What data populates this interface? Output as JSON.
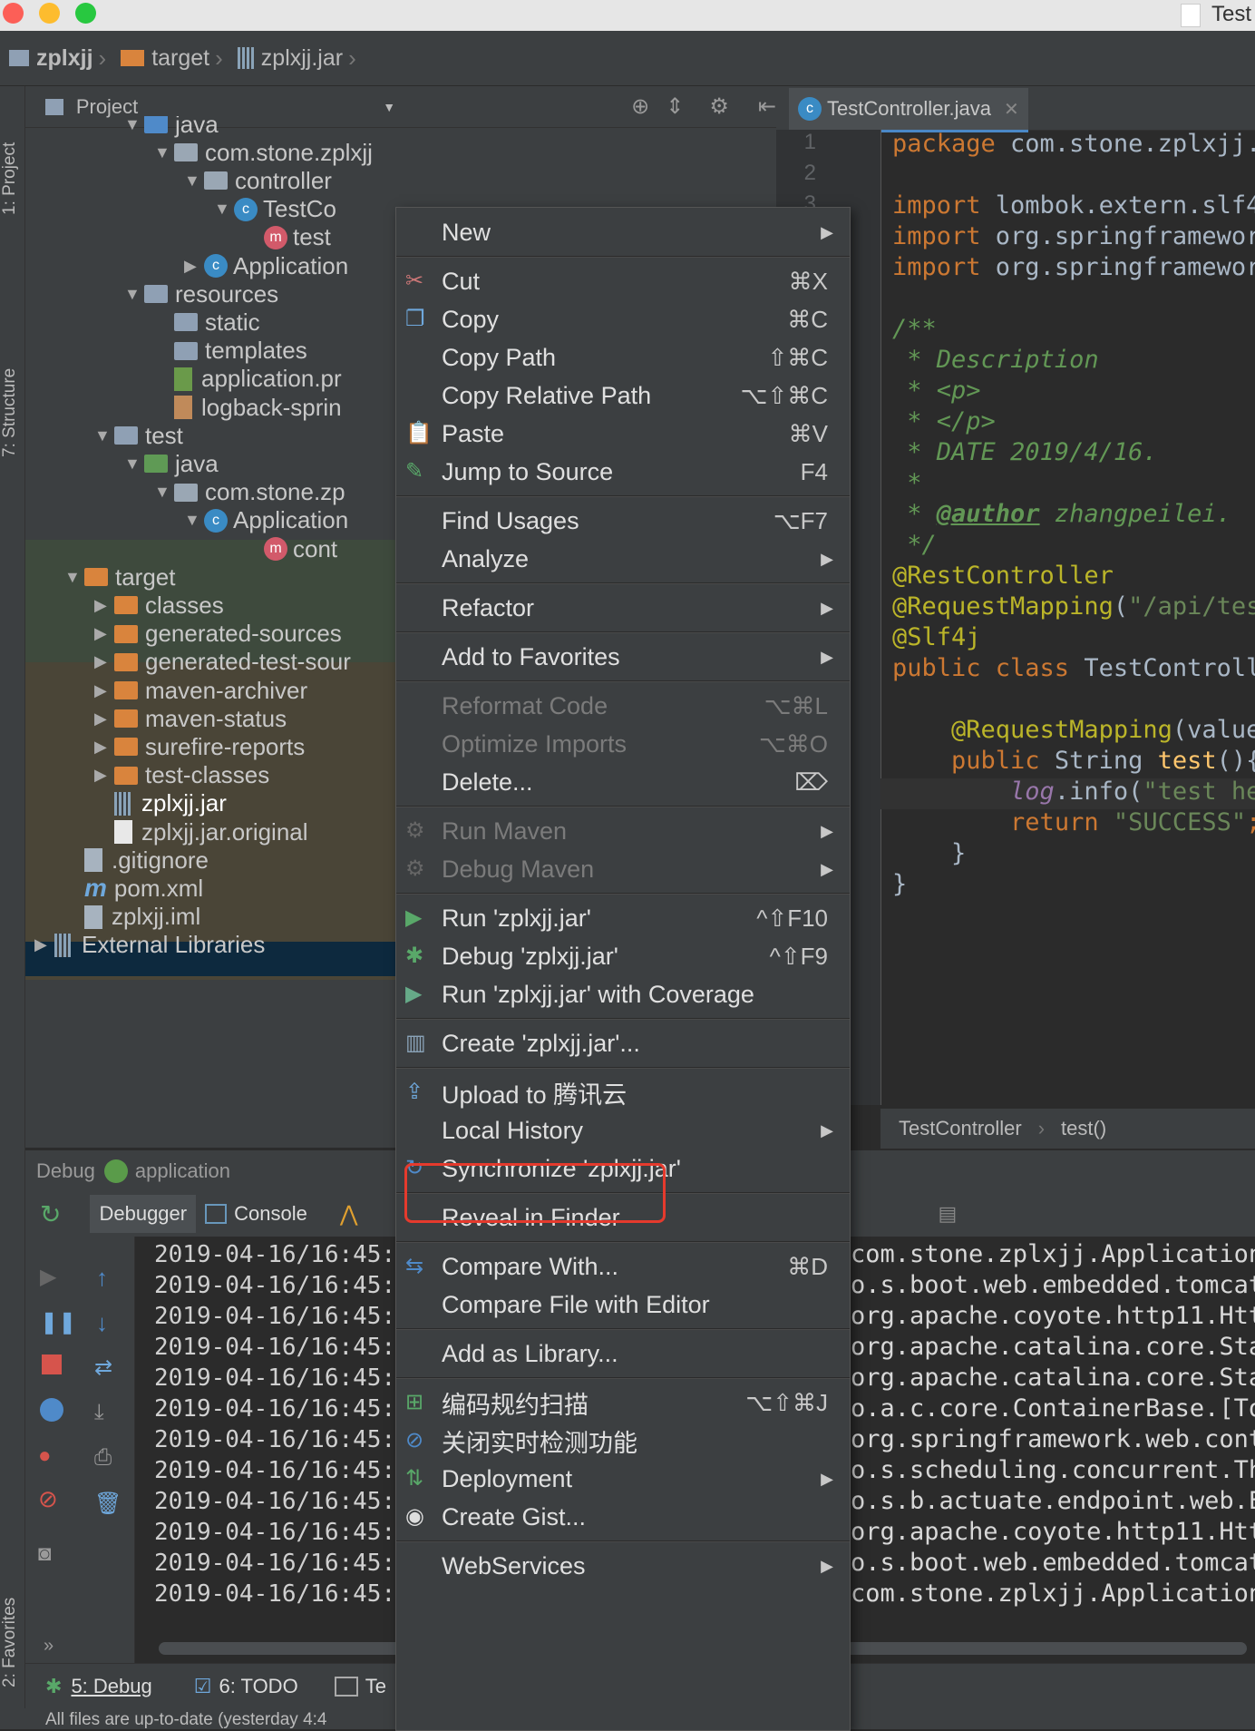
{
  "titlebar": {
    "title_right": "Test"
  },
  "navbar": {
    "items": [
      "zplxjj",
      "target",
      "zplxjj.jar"
    ]
  },
  "left_strip": {
    "tabs": [
      "1: Project",
      "7: Structure",
      "2: Favorites"
    ]
  },
  "project_panel": {
    "header": "Project",
    "tree": [
      {
        "label": "java",
        "depth": 3,
        "expand": "▼",
        "icon": "folder-blue"
      },
      {
        "label": "com.stone.zplxjj",
        "depth": 4,
        "expand": "▼",
        "icon": "package"
      },
      {
        "label": "controller",
        "depth": 5,
        "expand": "▼",
        "icon": "package"
      },
      {
        "label": "TestCo",
        "depth": 6,
        "expand": "▼",
        "icon": "class"
      },
      {
        "label": "test",
        "depth": 7,
        "expand": "",
        "icon": "method"
      },
      {
        "label": "Application",
        "depth": 5,
        "expand": "▶",
        "icon": "class-spring"
      },
      {
        "label": "resources",
        "depth": 3,
        "expand": "▼",
        "icon": "folder-resources"
      },
      {
        "label": "static",
        "depth": 4,
        "expand": "",
        "icon": "folder"
      },
      {
        "label": "templates",
        "depth": 4,
        "expand": "",
        "icon": "folder"
      },
      {
        "label": "application.pr",
        "depth": 4,
        "expand": "",
        "icon": "spring-file"
      },
      {
        "label": "logback-sprin",
        "depth": 4,
        "expand": "",
        "icon": "xml-file"
      },
      {
        "label": "test",
        "depth": 2,
        "expand": "▼",
        "icon": "folder"
      },
      {
        "label": "java",
        "depth": 3,
        "expand": "▼",
        "icon": "folder-green"
      },
      {
        "label": "com.stone.zp",
        "depth": 4,
        "expand": "▼",
        "icon": "package"
      },
      {
        "label": "Application",
        "depth": 5,
        "expand": "▼",
        "icon": "class"
      },
      {
        "label": "cont",
        "depth": 7,
        "expand": "",
        "icon": "method"
      },
      {
        "label": "target",
        "depth": 1,
        "expand": "▼",
        "icon": "folder-orange"
      },
      {
        "label": "classes",
        "depth": 2,
        "expand": "▶",
        "icon": "folder-orange"
      },
      {
        "label": "generated-sources",
        "depth": 2,
        "expand": "▶",
        "icon": "folder-orange"
      },
      {
        "label": "generated-test-sour",
        "depth": 2,
        "expand": "▶",
        "icon": "folder-orange"
      },
      {
        "label": "maven-archiver",
        "depth": 2,
        "expand": "▶",
        "icon": "folder-orange"
      },
      {
        "label": "maven-status",
        "depth": 2,
        "expand": "▶",
        "icon": "folder-orange"
      },
      {
        "label": "surefire-reports",
        "depth": 2,
        "expand": "▶",
        "icon": "folder-orange"
      },
      {
        "label": "test-classes",
        "depth": 2,
        "expand": "▶",
        "icon": "folder-orange"
      },
      {
        "label": "zplxjj.jar",
        "depth": 2,
        "expand": "",
        "icon": "jar"
      },
      {
        "label": "zplxjj.jar.original",
        "depth": 2,
        "expand": "",
        "icon": "file"
      },
      {
        "label": ".gitignore",
        "depth": 1,
        "expand": "",
        "icon": "text-file"
      },
      {
        "label": "pom.xml",
        "depth": 1,
        "expand": "",
        "icon": "maven"
      },
      {
        "label": "zplxjj.iml",
        "depth": 1,
        "expand": "",
        "icon": "iml"
      },
      {
        "label": "External Libraries",
        "depth": 0,
        "expand": "▶",
        "icon": "libraries"
      }
    ]
  },
  "editor": {
    "tab": "TestController.java",
    "line_numbers": [
      "1",
      "2",
      "3"
    ],
    "lines": [
      [
        "kw:package ",
        "plain:com.stone.zplxjj."
      ],
      [],
      [
        "kw:import ",
        "plain:lombok.extern.slf4"
      ],
      [
        "kw:import ",
        "plain:org.springframewor"
      ],
      [
        "kw:import ",
        "plain:org.springframewor"
      ],
      [],
      [
        "cmt:/**"
      ],
      [
        "cmt: * Description"
      ],
      [
        "cmt: * <p>"
      ],
      [
        "cmt: * </p>"
      ],
      [
        "cmt: * DATE 2019/4/16."
      ],
      [
        "cmt: *"
      ],
      [
        "cmt: * ",
        "cmtu:@author",
        "cmt: zhangpeilei."
      ],
      [
        "cmt: */"
      ],
      [
        "ann:@RestController"
      ],
      [
        "ann:@RequestMapping",
        "plain:(",
        "str:\"/api/tes"
      ],
      [
        "ann:@Slf4j"
      ],
      [
        "kw:public class ",
        "plain:TestControll"
      ],
      [],
      [
        "plain:    ",
        "ann:@RequestMapping",
        "plain:(value"
      ],
      [
        "plain:    ",
        "kw:public ",
        "plain:String ",
        "fn:test",
        "plain:(){"
      ],
      [
        "plain:        ",
        "purple:log",
        "plain:.info(",
        "str:\"test he"
      ],
      [
        "plain:        ",
        "kw:return ",
        "str:\"SUCCESS\"",
        "kw:;"
      ],
      [
        "plain:    }"
      ],
      [
        "plain:}"
      ]
    ],
    "crumbs": [
      "TestController",
      "test()"
    ]
  },
  "debug": {
    "header_label": "Debug",
    "config": "application",
    "tabs": [
      "Debugger",
      "Console"
    ],
    "timestamp": "2019-04-16/16:45:",
    "log_right": [
      "com.stone.zplxjj.Application",
      "o.s.boot.web.embedded.tomcat",
      "org.apache.coyote.http11.Htt",
      "org.apache.catalina.core.Sta",
      "org.apache.catalina.core.Sta",
      "o.a.c.core.ContainerBase.[To",
      "org.springframework.web.cont",
      "o.s.scheduling.concurrent.Th",
      "o.s.b.actuate.endpoint.web.E",
      "org.apache.coyote.http11.Htt",
      "o.s.boot.web.embedded.tomcat",
      "com.stone.zplxjj.Application"
    ]
  },
  "bottom_tabs": [
    "5: Debug",
    "6: TODO",
    "Te"
  ],
  "status": "All files are up-to-date (yesterday 4:4",
  "context_menu": {
    "items": [
      {
        "label": "New",
        "arrow": true
      },
      {
        "sep": true
      },
      {
        "label": "Cut",
        "shortcut": "⌘X",
        "icon": "scissors-icon"
      },
      {
        "label": "Copy",
        "shortcut": "⌘C",
        "icon": "copy-icon"
      },
      {
        "label": "Copy Path",
        "shortcut": "⇧⌘C"
      },
      {
        "label": "Copy Relative Path",
        "shortcut": "⌥⇧⌘C"
      },
      {
        "label": "Paste",
        "shortcut": "⌘V",
        "icon": "paste-icon"
      },
      {
        "label": "Jump to Source",
        "shortcut": "F4",
        "icon": "edit-icon"
      },
      {
        "sep": true
      },
      {
        "label": "Find Usages",
        "shortcut": "⌥F7"
      },
      {
        "label": "Analyze",
        "arrow": true
      },
      {
        "sep": true
      },
      {
        "label": "Refactor",
        "arrow": true
      },
      {
        "sep": true
      },
      {
        "label": "Add to Favorites",
        "arrow": true
      },
      {
        "sep": true
      },
      {
        "label": "Reformat Code",
        "shortcut": "⌥⌘L",
        "disabled": true
      },
      {
        "label": "Optimize Imports",
        "shortcut": "⌥⌘O",
        "disabled": true
      },
      {
        "label": "Delete...",
        "shortcut": "⌦"
      },
      {
        "sep": true
      },
      {
        "label": "Run Maven",
        "arrow": true,
        "disabled": true,
        "icon": "gear-icon"
      },
      {
        "label": "Debug Maven",
        "arrow": true,
        "disabled": true,
        "icon": "gear-icon"
      },
      {
        "sep": true
      },
      {
        "label": "Run 'zplxjj.jar'",
        "shortcut": "^⇧F10",
        "icon": "run-icon"
      },
      {
        "label": "Debug 'zplxjj.jar'",
        "shortcut": "^⇧F9",
        "icon": "bug-icon"
      },
      {
        "label": "Run 'zplxjj.jar' with Coverage",
        "icon": "coverage-icon"
      },
      {
        "sep": true
      },
      {
        "label": "Create 'zplxjj.jar'...",
        "icon": "jar-icon"
      },
      {
        "sep": true
      },
      {
        "label": "Upload to 腾讯云",
        "icon": "upload-icon",
        "highlight": true
      },
      {
        "label": "Local History",
        "arrow": true
      },
      {
        "label": "Synchronize 'zplxjj.jar'",
        "icon": "sync-icon"
      },
      {
        "sep": true
      },
      {
        "label": "Reveal in Finder"
      },
      {
        "sep": true
      },
      {
        "label": "Compare With...",
        "shortcut": "⌘D",
        "icon": "compare-icon"
      },
      {
        "label": "Compare File with Editor"
      },
      {
        "sep": true
      },
      {
        "label": "Add as Library..."
      },
      {
        "sep": true
      },
      {
        "label": "编码规约扫描",
        "shortcut": "⌥⇧⌘J",
        "icon": "scan-icon"
      },
      {
        "label": "关闭实时检测功能",
        "icon": "block-icon"
      },
      {
        "label": "Deployment",
        "arrow": true,
        "icon": "deploy-icon"
      },
      {
        "label": "Create Gist...",
        "icon": "github-icon"
      },
      {
        "sep": true
      },
      {
        "label": "WebServices",
        "arrow": true
      }
    ]
  },
  "colors": {
    "highlight_border": "#e53a2d",
    "selection": "#0d293e",
    "accent": "#4a88c7"
  }
}
